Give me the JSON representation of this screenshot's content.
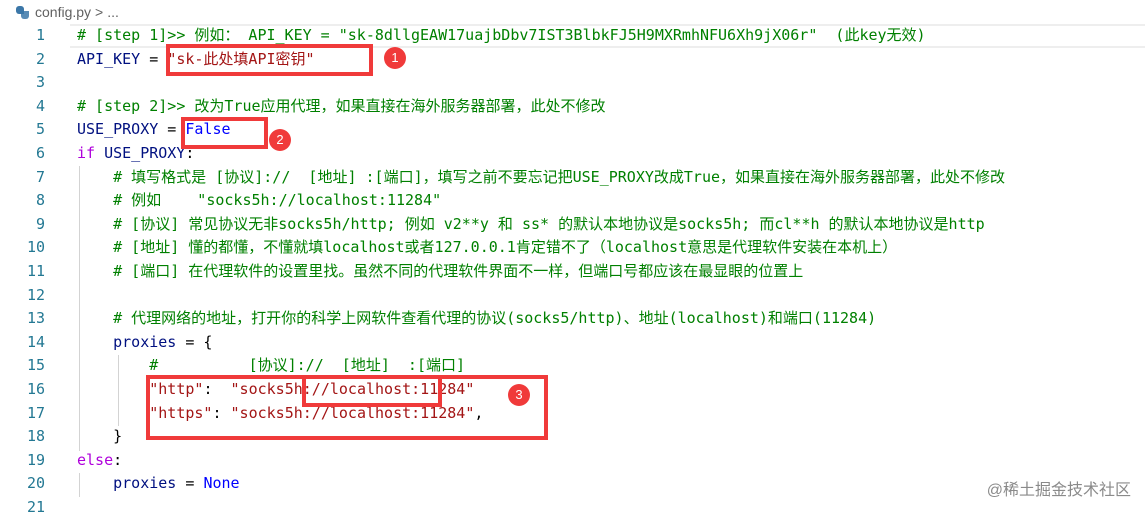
{
  "breadcrumb": {
    "file": "config.py",
    "separator": ">",
    "rest": "..."
  },
  "lines": [
    {
      "n": "1",
      "parts": [
        [
          "c",
          "# [step 1]>> 例如： API_KEY = \"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\"  (此key无效)"
        ]
      ]
    },
    {
      "n": "2",
      "parts": [
        [
          "p",
          "API_KEY"
        ],
        [
          "t",
          " = "
        ],
        [
          "s",
          "\"sk-此处填API密钥\""
        ]
      ]
    },
    {
      "n": "3",
      "parts": []
    },
    {
      "n": "4",
      "parts": [
        [
          "c",
          "# [step 2]>> 改为True应用代理，如果直接在海外服务器部署，此处不修改"
        ]
      ]
    },
    {
      "n": "5",
      "parts": [
        [
          "p",
          "USE_PROXY"
        ],
        [
          "t",
          " = "
        ],
        [
          "k",
          "False"
        ]
      ]
    },
    {
      "n": "6",
      "parts": [
        [
          "kw",
          "if"
        ],
        [
          "t",
          " "
        ],
        [
          "p",
          "USE_PROXY"
        ],
        [
          "t",
          ":"
        ]
      ]
    },
    {
      "n": "7",
      "parts": [
        [
          "t",
          "    "
        ],
        [
          "c",
          "# 填写格式是 [协议]://  [地址] :[端口]，填写之前不要忘记把USE_PROXY改成True，如果直接在海外服务器部署，此处不修改"
        ]
      ]
    },
    {
      "n": "8",
      "parts": [
        [
          "t",
          "    "
        ],
        [
          "c",
          "# 例如    \"socks5h://localhost:11284\""
        ]
      ]
    },
    {
      "n": "9",
      "parts": [
        [
          "t",
          "    "
        ],
        [
          "c",
          "# [协议] 常见协议无非socks5h/http; 例如 v2**y 和 ss* 的默认本地协议是socks5h; 而cl**h 的默认本地协议是http"
        ]
      ]
    },
    {
      "n": "10",
      "parts": [
        [
          "t",
          "    "
        ],
        [
          "c",
          "# [地址] 懂的都懂，不懂就填localhost或者127.0.0.1肯定错不了（localhost意思是代理软件安装在本机上）"
        ]
      ]
    },
    {
      "n": "11",
      "parts": [
        [
          "t",
          "    "
        ],
        [
          "c",
          "# [端口] 在代理软件的设置里找。虽然不同的代理软件界面不一样，但端口号都应该在最显眼的位置上"
        ]
      ]
    },
    {
      "n": "12",
      "parts": []
    },
    {
      "n": "13",
      "parts": [
        [
          "t",
          "    "
        ],
        [
          "c",
          "# 代理网络的地址，打开你的科学上网软件查看代理的协议(socks5/http)、地址(localhost)和端口(11284)"
        ]
      ]
    },
    {
      "n": "14",
      "parts": [
        [
          "t",
          "    "
        ],
        [
          "p",
          "proxies"
        ],
        [
          "t",
          " = {"
        ]
      ]
    },
    {
      "n": "15",
      "parts": [
        [
          "t",
          "        "
        ],
        [
          "c",
          "#          [协议]://  [地址]  :[端口]"
        ]
      ]
    },
    {
      "n": "16",
      "parts": [
        [
          "t",
          "        "
        ],
        [
          "s",
          "\"http\""
        ],
        [
          "t",
          ":  "
        ],
        [
          "s",
          "\"socks5h://localhost:11284\""
        ]
      ]
    },
    {
      "n": "17",
      "parts": [
        [
          "t",
          "        "
        ],
        [
          "s",
          "\"https\""
        ],
        [
          "t",
          ": "
        ],
        [
          "s",
          "\"socks5h://localhost:11284\""
        ],
        [
          "t",
          ","
        ]
      ]
    },
    {
      "n": "18",
      "parts": [
        [
          "t",
          "    }"
        ]
      ]
    },
    {
      "n": "19",
      "parts": [
        [
          "kw",
          "else"
        ],
        [
          "t",
          ":"
        ]
      ]
    },
    {
      "n": "20",
      "parts": [
        [
          "t",
          "    "
        ],
        [
          "p",
          "proxies"
        ],
        [
          "t",
          " = "
        ],
        [
          "k",
          "None"
        ]
      ]
    },
    {
      "n": "21",
      "parts": []
    }
  ],
  "annotations": [
    {
      "label": "1",
      "target": "API_KEY value"
    },
    {
      "label": "2",
      "target": "USE_PROXY value"
    },
    {
      "label": "3",
      "target": "proxies entries"
    }
  ],
  "watermark": "@稀土掘金技术社区",
  "colors": {
    "comment": "#008000",
    "string": "#a31515",
    "keyword": "#0000ff",
    "control": "#af00db",
    "variable": "#001080",
    "line_number": "#237893",
    "annotation": "#f03a3a"
  }
}
